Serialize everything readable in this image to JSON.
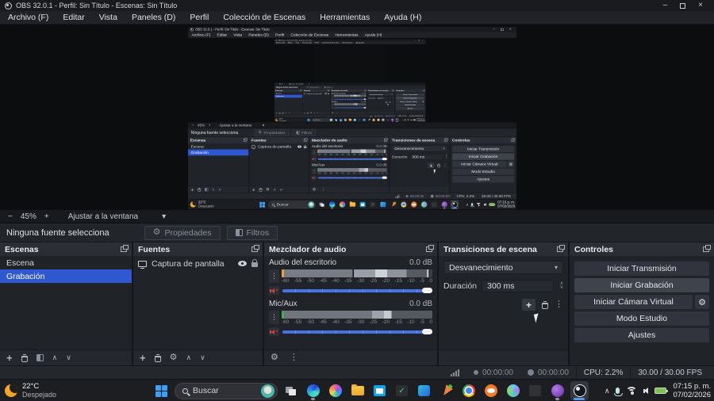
{
  "window": {
    "title": "OBS 32.0.1 - Perfil: Sin Título - Escenas: Sin Título",
    "minimize": "–",
    "close": "×"
  },
  "menu": {
    "items": [
      "Archivo (F)",
      "Editar",
      "Vista",
      "Paneles (D)",
      "Perfil",
      "Colección de Escenas",
      "Herramientas",
      "Ayuda (H)"
    ]
  },
  "zoombar": {
    "zoom_out": "−",
    "zoom_level": "45%",
    "zoom_in": "+",
    "fit_label": "Ajustar a la ventana",
    "caret": "▾"
  },
  "source_toolbar": {
    "status": "Ninguna fuente selecciona",
    "properties_label": "Propiedades",
    "filters_label": "Filtros"
  },
  "scenes": {
    "title": "Escenas",
    "items": [
      "Escena",
      "Grabación"
    ],
    "selected": "Grabación"
  },
  "sources": {
    "title": "Fuentes",
    "item_label": "Captura de pantalla"
  },
  "mixer": {
    "title": "Mezclador de audio",
    "channels": [
      {
        "name": "Audio del escritorio",
        "db": "0.0 dB"
      },
      {
        "name": "Mic/Aux",
        "db": "0.0 dB"
      }
    ],
    "ticks": [
      "-60",
      "-55",
      "-50",
      "-45",
      "-40",
      "-35",
      "-30",
      "-25",
      "-20",
      "-15",
      "-10",
      "-5",
      "0"
    ]
  },
  "transitions": {
    "title": "Transiciones de escena",
    "value": "Desvanecimiento",
    "duration_label": "Duración",
    "duration_value": "300 ms"
  },
  "controls": {
    "title": "Controles",
    "stream": "Iniciar Transmisión",
    "record": "Iniciar Grabación",
    "vcam": "Iniciar Cámara Virtual",
    "studio": "Modo Estudio",
    "settings": "Ajustes"
  },
  "statusbar": {
    "stream_time": "00:00:00",
    "rec_time": "00:00:00",
    "cpu": "CPU: 2.2%",
    "fps": "30.00 / 30.00 FPS"
  },
  "taskbar": {
    "weather_temp": "22°C",
    "weather_desc": "Despejado",
    "search_label": "Buscar",
    "clock_time": "07:15 p. m.",
    "clock_date": "07/02/2026"
  }
}
